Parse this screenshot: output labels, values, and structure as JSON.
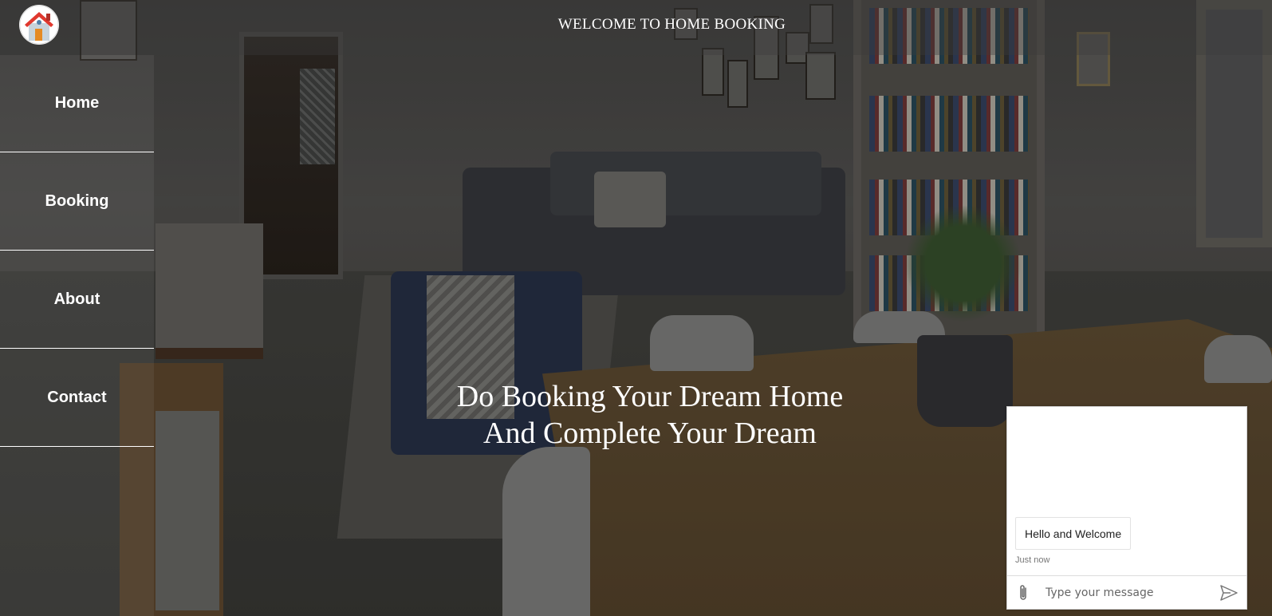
{
  "header": {
    "title": "WELCOME TO HOME BOOKING",
    "logo_icon": "house-icon"
  },
  "sidebar": {
    "items": [
      {
        "label": "Home"
      },
      {
        "label": "Booking"
      },
      {
        "label": "About"
      },
      {
        "label": "Contact"
      }
    ]
  },
  "hero": {
    "line1": "Do Booking Your Dream Home",
    "line2": "And Complete Your Dream"
  },
  "chat": {
    "message": "Hello and Welcome",
    "timestamp": "Just now",
    "input_placeholder": "Type your message",
    "attach_icon": "paperclip-icon",
    "send_icon": "send-icon"
  },
  "colors": {
    "overlay_text": "#ffffff",
    "logo_roof": "#e0392f",
    "logo_door": "#e58a23"
  }
}
